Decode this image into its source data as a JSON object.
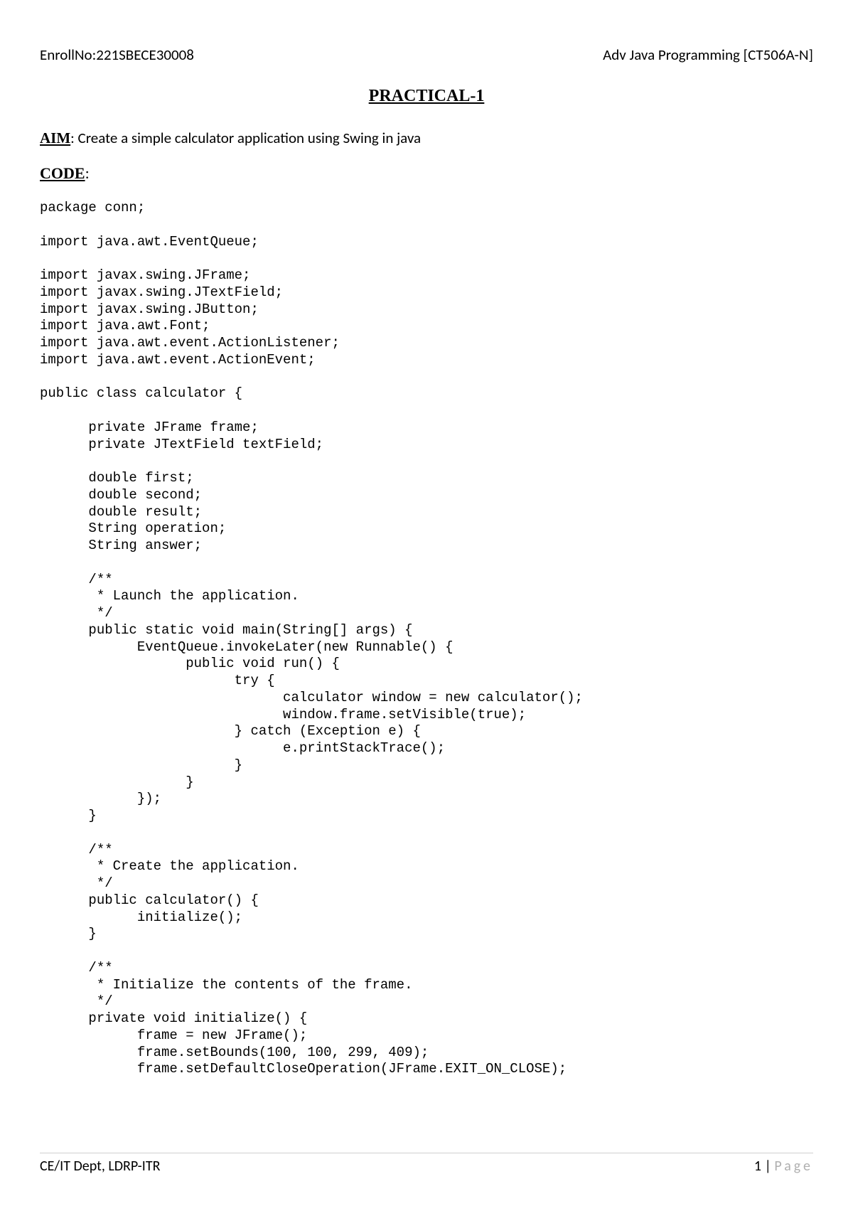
{
  "header": {
    "left": "EnrollNo:221SBECE30008",
    "right": "Adv Java Programming [CT506A-N]"
  },
  "title": "PRACTICAL-1",
  "aim": {
    "label": "AIM",
    "text": ": Create a simple calculator application using Swing in java"
  },
  "code_label": "CODE",
  "code_label_colon": ":",
  "code": "package conn;\n\nimport java.awt.EventQueue;\n\nimport javax.swing.JFrame;\nimport javax.swing.JTextField;\nimport javax.swing.JButton;\nimport java.awt.Font;\nimport java.awt.event.ActionListener;\nimport java.awt.event.ActionEvent;\n\npublic class calculator {\n\n      private JFrame frame;\n      private JTextField textField;\n\n      double first;\n      double second;\n      double result;\n      String operation;\n      String answer;\n\n      /**\n       * Launch the application.\n       */\n      public static void main(String[] args) {\n            EventQueue.invokeLater(new Runnable() {\n                  public void run() {\n                        try {\n                              calculator window = new calculator();\n                              window.frame.setVisible(true);\n                        } catch (Exception e) {\n                              e.printStackTrace();\n                        }\n                  }\n            });\n      }\n\n      /**\n       * Create the application.\n       */\n      public calculator() {\n            initialize();\n      }\n\n      /**\n       * Initialize the contents of the frame.\n       */\n      private void initialize() {\n            frame = new JFrame();\n            frame.setBounds(100, 100, 299, 409);\n            frame.setDefaultCloseOperation(JFrame.EXIT_ON_CLOSE);",
  "footer": {
    "left": "CE/IT Dept, LDRP-ITR",
    "page_num": "1",
    "page_sep": " | ",
    "page_word": "Page"
  }
}
